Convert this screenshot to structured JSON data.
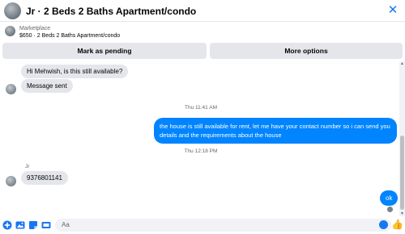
{
  "header": {
    "title": "Jr · 2 Beds 2 Baths Apartment/condo",
    "close_glyph": "✕"
  },
  "listing": {
    "label": "Marketplace",
    "detail": "$650 · 2 Beds 2 Baths Apartment/condo"
  },
  "actions": {
    "mark_pending": "Mark as pending",
    "more_options": "More options"
  },
  "conversation": {
    "msg1": "Hi Mehwish, is this still available?",
    "msg2": "Message sent",
    "ts1": "Thu 11:41 AM",
    "out1": "the house is still available for rent, let me have your contact number so i can send you details and the requirements about the house",
    "ts2": "Thu 12:18 PM",
    "sender": "Jr",
    "msg3": "9376801141",
    "out2": "ok"
  },
  "composer": {
    "placeholder": "Aa"
  },
  "colors": {
    "accent": "#1877f2",
    "bubble_out": "#0084ff",
    "bubble_in": "#e4e6eb"
  }
}
